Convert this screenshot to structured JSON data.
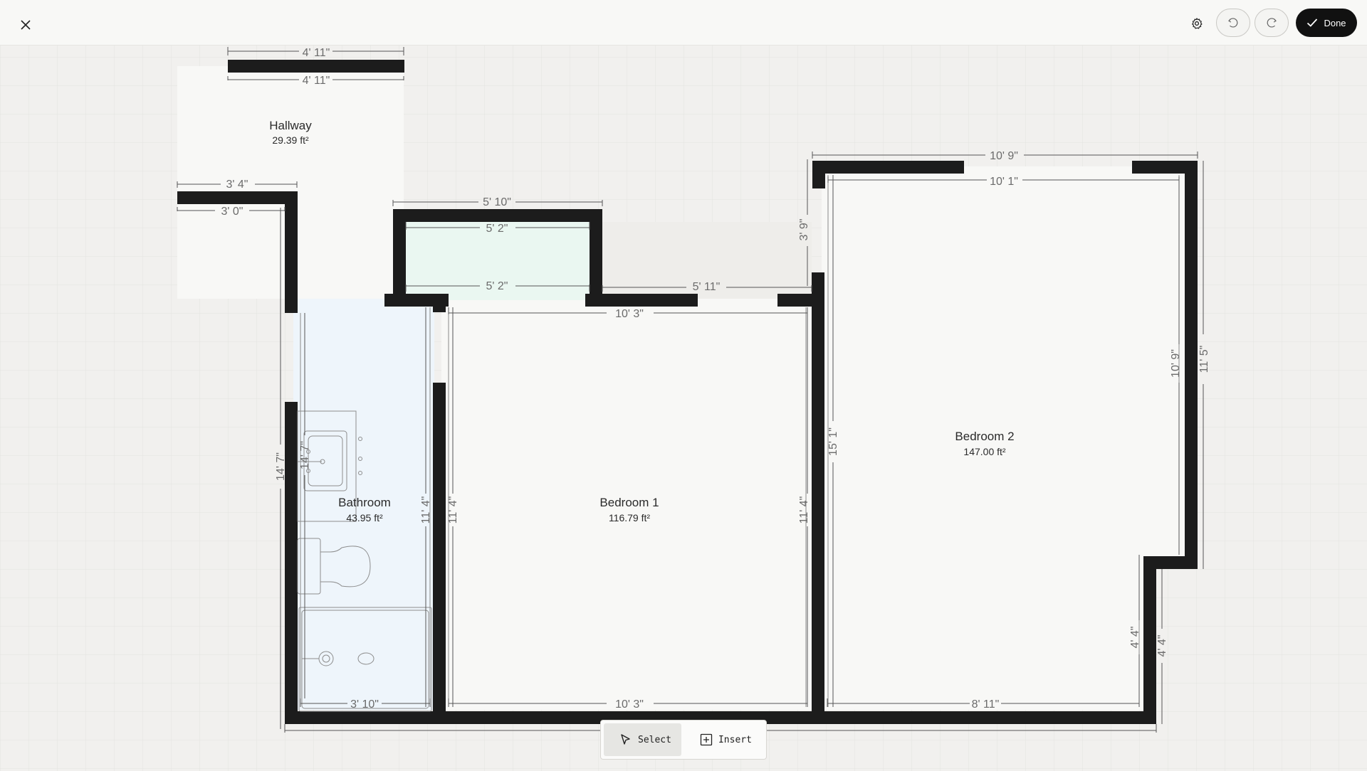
{
  "topbar": {
    "done_label": "Done",
    "icons": [
      "close-icon",
      "gear-icon",
      "undo-icon",
      "redo-icon",
      "check-icon"
    ]
  },
  "rooms": [
    {
      "name": "Hallway",
      "area": "29.39 ft²"
    },
    {
      "name": "Bathroom",
      "area": "43.95 ft²"
    },
    {
      "name": "Bedroom 1",
      "area": "116.79 ft²"
    },
    {
      "name": "Bedroom 2",
      "area": "147.00 ft²"
    }
  ],
  "dimensions": {
    "hall_top_outer": "4' 11\"",
    "hall_top_inner": "4' 11\"",
    "hall_left_outer": "3'  4\"",
    "hall_left_inner": "3'  0\"",
    "closet_top_outer": "5' 10\"",
    "closet_top_inner": "5'  2\"",
    "closet_bottom_inner": "5'  2\"",
    "corridor_top": "5' 11\"",
    "bed1_top": "10'  3\"",
    "bed1_bottom": "10'  3\"",
    "bed1_left": "11'  4\"",
    "bed1_right": "11'  4\"",
    "bath_bottom": "3' 10\"",
    "bath_left_outer": "14'  7\"",
    "bath_left_inner": "14'  7\"",
    "bath_right": "11'  4\"",
    "bed2_top_outer": "10'  9\"",
    "bed2_top_inner": "10'  1\"",
    "bed2_left_small": "3'  9\"",
    "bed2_left": "15'  1\"",
    "bed2_right_inner": "10'  9\"",
    "bed2_right_outer": "11'  5\"",
    "bed2_bottom": "8' 11\"",
    "bed2_notch_inner": "4'  4\"",
    "bed2_notch_outer": "4'  4\""
  },
  "toolbar": {
    "select_label": "Select",
    "insert_label": "Insert",
    "icons": [
      "cursor-icon",
      "plus-square-icon"
    ]
  },
  "colors": {
    "wall": "#1c1c1c",
    "background": "#f1f0ee",
    "grid": "#e4e3e0",
    "bathroom_fill": "#eef5fb",
    "closet_fill": "#eaf7f1",
    "room_fill": "#f8f8f6"
  }
}
